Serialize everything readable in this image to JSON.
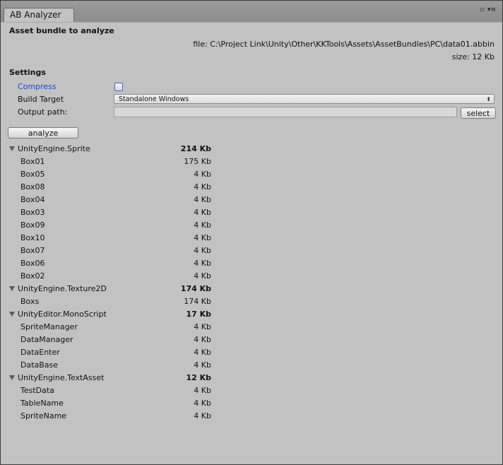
{
  "window": {
    "tab_title": "AB Analyzer",
    "ctrl_maximize": "▫",
    "ctrl_menu": "▾≡"
  },
  "asset_section": {
    "title": "Asset bundle to analyze",
    "file_line": "file: C:\\Project Link\\Unity\\Other\\KKTools\\Assets\\AssetBundles\\PC\\data01.abbin",
    "size_line": "size: 12 Kb"
  },
  "settings": {
    "title": "Settings",
    "compress_label": "Compress",
    "compress_checked": false,
    "build_target_label": "Build Target",
    "build_target_value": "Standalone Windows",
    "output_path_label": "Output path:",
    "output_path_value": "",
    "select_button": "select"
  },
  "analyze_button": "analyze",
  "groups": [
    {
      "name": "UnityEngine.Sprite",
      "size": "214 Kb",
      "items": [
        {
          "name": "Box01",
          "size": "175 Kb"
        },
        {
          "name": "Box05",
          "size": "4 Kb"
        },
        {
          "name": "Box08",
          "size": "4 Kb"
        },
        {
          "name": "Box04",
          "size": "4 Kb"
        },
        {
          "name": "Box03",
          "size": "4 Kb"
        },
        {
          "name": "Box09",
          "size": "4 Kb"
        },
        {
          "name": "Box10",
          "size": "4 Kb"
        },
        {
          "name": "Box07",
          "size": "4 Kb"
        },
        {
          "name": "Box06",
          "size": "4 Kb"
        },
        {
          "name": "Box02",
          "size": "4 Kb"
        }
      ]
    },
    {
      "name": "UnityEngine.Texture2D",
      "size": "174 Kb",
      "items": [
        {
          "name": "Boxs",
          "size": "174 Kb"
        }
      ]
    },
    {
      "name": "UnityEditor.MonoScript",
      "size": "17 Kb",
      "items": [
        {
          "name": "SpriteManager",
          "size": "4 Kb"
        },
        {
          "name": "DataManager",
          "size": "4 Kb"
        },
        {
          "name": "DataEnter",
          "size": "4 Kb"
        },
        {
          "name": "DataBase",
          "size": "4 Kb"
        }
      ]
    },
    {
      "name": "UnityEngine.TextAsset",
      "size": "12 Kb",
      "items": [
        {
          "name": "TestData",
          "size": "4 Kb"
        },
        {
          "name": "TableName",
          "size": "4 Kb"
        },
        {
          "name": "SpriteName",
          "size": "4 Kb"
        }
      ]
    }
  ]
}
